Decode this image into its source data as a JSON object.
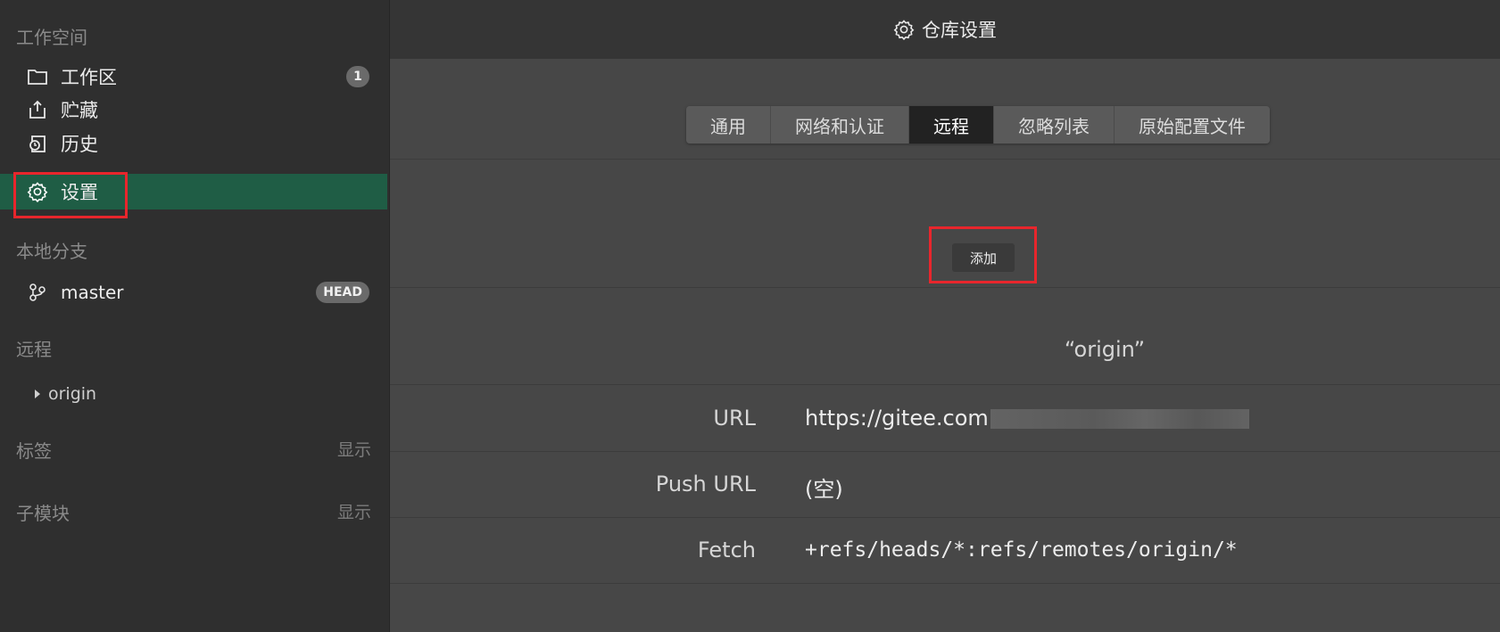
{
  "sidebar": {
    "workspace_header": "工作空间",
    "items": [
      {
        "label": "工作区",
        "icon": "folder-icon",
        "badge": "1"
      },
      {
        "label": "贮藏",
        "icon": "stash-icon"
      },
      {
        "label": "历史",
        "icon": "history-icon"
      },
      {
        "label": "设置",
        "icon": "gear-icon",
        "active": true
      }
    ],
    "local_branches_header": "本地分支",
    "branch": {
      "name": "master",
      "badge": "HEAD",
      "icon": "branch-icon"
    },
    "remotes_header": "远程",
    "remote": {
      "name": "origin",
      "icon": "caret-right-icon"
    },
    "tags_header": "标签",
    "tags_show": "显示",
    "submodules_header": "子模块",
    "submodules_show": "显示"
  },
  "main": {
    "title": "仓库设置",
    "tabs": [
      {
        "label": "通用"
      },
      {
        "label": "网络和认证"
      },
      {
        "label": "远程",
        "active": true
      },
      {
        "label": "忽略列表"
      },
      {
        "label": "原始配置文件"
      }
    ],
    "add_button": "添加",
    "remote_name": "“origin”",
    "fields": {
      "url_label": "URL",
      "url_value": "https://gitee.com",
      "push_url_label": "Push URL",
      "push_url_value": "(空)",
      "fetch_label": "Fetch",
      "fetch_value": "+refs/heads/*:refs/remotes/origin/*"
    }
  },
  "colors": {
    "active_item": "#1f5d45",
    "highlight_box": "#e8262c"
  }
}
